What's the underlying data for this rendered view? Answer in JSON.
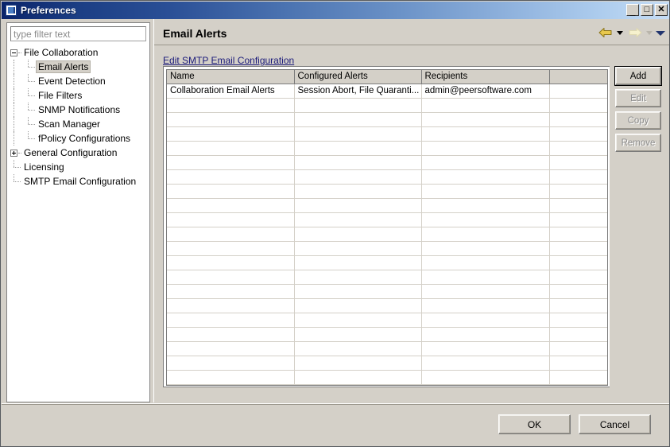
{
  "window": {
    "title": "Preferences",
    "icon": "preferences-window-icon",
    "controls": {
      "minimize": "_",
      "maximize": "□",
      "close": "✕"
    }
  },
  "sidebar": {
    "filter": {
      "value": "",
      "placeholder": "type filter text"
    },
    "items": [
      {
        "label": "File Collaboration",
        "level": 0,
        "state": "expanded",
        "selected": false
      },
      {
        "label": "Email Alerts",
        "level": 1,
        "state": "leaf",
        "selected": true
      },
      {
        "label": "Event Detection",
        "level": 1,
        "state": "leaf",
        "selected": false
      },
      {
        "label": "File Filters",
        "level": 1,
        "state": "leaf",
        "selected": false
      },
      {
        "label": "SNMP Notifications",
        "level": 1,
        "state": "leaf",
        "selected": false
      },
      {
        "label": "Scan Manager",
        "level": 1,
        "state": "leaf",
        "selected": false
      },
      {
        "label": "fPolicy Configurations",
        "level": 1,
        "state": "leaf",
        "selected": false
      },
      {
        "label": "General Configuration",
        "level": 0,
        "state": "collapsed",
        "selected": false
      },
      {
        "label": "Licensing",
        "level": 0,
        "state": "leaf",
        "selected": false
      },
      {
        "label": "SMTP Email Configuration",
        "level": 0,
        "state": "leaf",
        "selected": false
      }
    ]
  },
  "page": {
    "title": "Email Alerts",
    "link_label": "Edit SMTP Email Configuration",
    "nav": {
      "back_icon": "back-arrow-icon",
      "back_menu_icon": "chevron-down-icon",
      "forward_icon": "forward-arrow-icon",
      "forward_menu_icon": "chevron-down-icon",
      "menu_icon": "chevron-down-icon"
    }
  },
  "table": {
    "columns": [
      "Name",
      "Configured Alerts",
      "Recipients",
      ""
    ],
    "rows": [
      [
        "Collaboration Email Alerts",
        "Session Abort, File Quaranti...",
        "admin@peersoftware.com",
        ""
      ]
    ],
    "empty_row_count": 21
  },
  "side_buttons": [
    {
      "label": "Add",
      "enabled": true,
      "focused": true
    },
    {
      "label": "Edit",
      "enabled": false,
      "focused": false
    },
    {
      "label": "Copy",
      "enabled": false,
      "focused": false
    },
    {
      "label": "Remove",
      "enabled": false,
      "focused": false
    }
  ],
  "footer": {
    "ok_label": "OK",
    "cancel_label": "Cancel"
  },
  "colors": {
    "title_bar_start": "#0a246a",
    "title_bar_end": "#c6ddf5",
    "dialog_face": "#d4d0c8",
    "link": "#1a1a7a",
    "back_arrow": "#e6c84f",
    "forward_arrow": "#f3eec2"
  }
}
